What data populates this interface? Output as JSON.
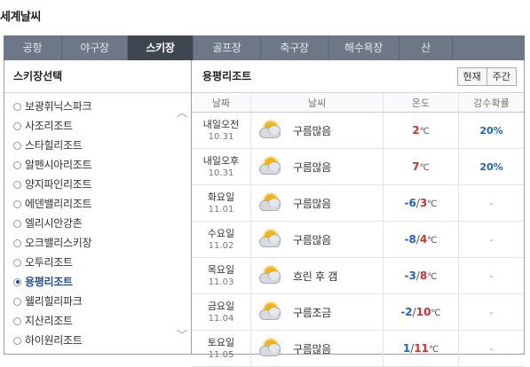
{
  "page_title": "세계날씨",
  "tabs": [
    {
      "label": "공항",
      "active": false
    },
    {
      "label": "야구장",
      "active": false
    },
    {
      "label": "스키장",
      "active": true
    },
    {
      "label": "골프장",
      "active": false
    },
    {
      "label": "축구장",
      "active": false
    },
    {
      "label": "해수욕장",
      "active": false
    },
    {
      "label": "산",
      "active": false
    }
  ],
  "left": {
    "title": "스키장선택",
    "resorts": [
      {
        "name": "보광휘닉스파크",
        "selected": false
      },
      {
        "name": "사조리조트",
        "selected": false
      },
      {
        "name": "스타힐리조트",
        "selected": false
      },
      {
        "name": "알펜시아리조트",
        "selected": false
      },
      {
        "name": "양지파인리조트",
        "selected": false
      },
      {
        "name": "에덴밸리리조트",
        "selected": false
      },
      {
        "name": "엘리시안강촌",
        "selected": false
      },
      {
        "name": "오크밸리스키장",
        "selected": false
      },
      {
        "name": "오투리조트",
        "selected": false
      },
      {
        "name": "용평리조트",
        "selected": true
      },
      {
        "name": "웰리힐리파크",
        "selected": false
      },
      {
        "name": "지산리조트",
        "selected": false
      },
      {
        "name": "하이원리조트",
        "selected": false
      }
    ],
    "scroll_up": "︿",
    "scroll_down": "﹀"
  },
  "right": {
    "title": "용평리조트",
    "toggle": {
      "current": "현재",
      "weekly": "주간"
    },
    "columns": {
      "date": "날짜",
      "weather": "날씨",
      "temp": "온도",
      "rain": "강수확률"
    },
    "unit": "℃",
    "rows": [
      {
        "day": "내일오전",
        "date": "10.31",
        "weather": "구름많음",
        "icon": "partly-cloudy-icon",
        "min": "",
        "max": "2",
        "rain": "20%"
      },
      {
        "day": "내일오후",
        "date": "10.31",
        "weather": "구름많음",
        "icon": "partly-cloudy-icon",
        "min": "",
        "max": "7",
        "rain": "20%"
      },
      {
        "day": "화요일",
        "date": "11.01",
        "weather": "구름많음",
        "icon": "partly-cloudy-icon",
        "min": "-6",
        "max": "3",
        "rain": "-"
      },
      {
        "day": "수요일",
        "date": "11.02",
        "weather": "구름많음",
        "icon": "partly-cloudy-icon",
        "min": "-8",
        "max": "4",
        "rain": "-"
      },
      {
        "day": "목요일",
        "date": "11.03",
        "weather": "흐린 후 갬",
        "icon": "cloudy-then-clear-icon",
        "min": "-3",
        "max": "8",
        "rain": "-"
      },
      {
        "day": "금요일",
        "date": "11.04",
        "weather": "구름조금",
        "icon": "partly-sunny-icon",
        "min": "-2",
        "max": "10",
        "rain": "-"
      },
      {
        "day": "토요일",
        "date": "11.05",
        "weather": "구름많음",
        "icon": "partly-cloudy-icon",
        "min": "1",
        "max": "11",
        "rain": "-"
      }
    ]
  }
}
